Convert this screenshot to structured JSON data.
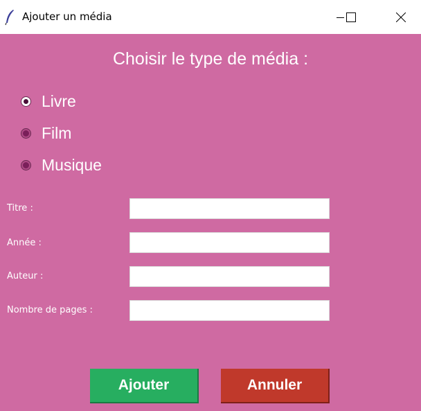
{
  "window": {
    "title": "Ajouter un média",
    "app_icon": "feather-icon",
    "controls": [
      "minimize-icon",
      "maximize-icon",
      "close-icon"
    ]
  },
  "form": {
    "heading": "Choisir le type de média :",
    "media_types": [
      {
        "label": "Livre",
        "checked": true
      },
      {
        "label": "Film",
        "checked": false
      },
      {
        "label": "Musique",
        "checked": false
      }
    ],
    "fields": [
      {
        "label": "Titre :",
        "value": ""
      },
      {
        "label": "Année :",
        "value": ""
      },
      {
        "label": "Auteur :",
        "value": ""
      },
      {
        "label": "Nombre de pages :",
        "value": ""
      }
    ],
    "buttons": {
      "add": "Ajouter",
      "cancel": "Annuler"
    }
  },
  "colors": {
    "background": "#cf6aa2",
    "add_button": "#27ae60",
    "cancel_button": "#c0392b",
    "text": "#ffffff"
  }
}
